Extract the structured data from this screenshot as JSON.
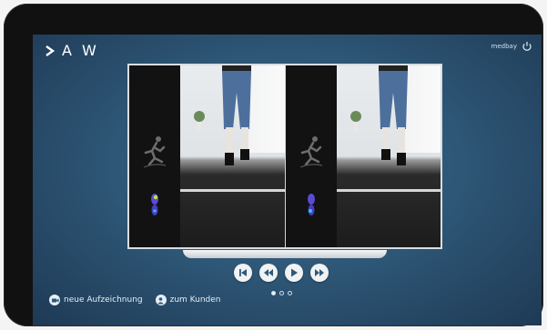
{
  "brand": {
    "logo_text": "A W"
  },
  "topbar": {
    "user_label": "medbay"
  },
  "player": {
    "controls": [
      "skip-back",
      "rewind",
      "play",
      "fast-forward"
    ],
    "pagination": {
      "current": 1,
      "total": 3
    }
  },
  "footer": {
    "new_recording_label": "neue Aufzeichnung",
    "customer_label": "zum Kunden"
  },
  "colors": {
    "accent": "#2f5878",
    "frame": "#d8dde2"
  }
}
